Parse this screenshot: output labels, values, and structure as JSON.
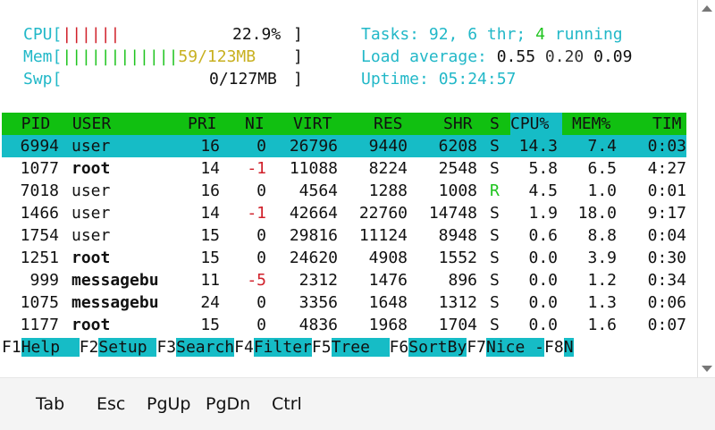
{
  "meters": {
    "cpu_label": "CPU[",
    "cpu_bar": "||||||",
    "cpu_value": "22.9%",
    "cpu_close": "]",
    "mem_label": "Mem[",
    "mem_bar_used": "||||||||||||",
    "mem_value": "59/123MB",
    "mem_close": "]",
    "swp_label": "Swp[",
    "swp_value": "0/127MB",
    "swp_close": "]"
  },
  "summary": {
    "tasks_label": "Tasks: ",
    "tasks_count": "92",
    "sep1": ", ",
    "threads": "6",
    "thr_label": " thr; ",
    "running": "4",
    "running_label": " running",
    "load_label": "Load average: ",
    "load1": "0.55",
    "load5": "0.20",
    "load15": "0.09",
    "uptime_label": "Uptime: ",
    "uptime": "05:24:57"
  },
  "columns": {
    "pid": "  PID",
    "user": " USER",
    "pri": "PRI",
    "ni": "NI",
    "virt": "VIRT",
    "res": "RES",
    "shr": "SHR",
    "s": "S",
    "cpu": "CPU%",
    "mem": "MEM%",
    "time": "TIM"
  },
  "processes": [
    {
      "pid": "6994",
      "user": "user",
      "pri": "16",
      "ni": "0",
      "virt": "26796",
      "res": "9440",
      "shr": "6208",
      "s": "S",
      "cpu": "14.3",
      "mem": "7.4",
      "time": "0:03"
    },
    {
      "pid": "1077",
      "user": "root",
      "pri": "14",
      "ni": "-1",
      "virt": "11088",
      "res": "8224",
      "shr": "2548",
      "s": "S",
      "cpu": "5.8",
      "mem": "6.5",
      "time": "4:27"
    },
    {
      "pid": "7018",
      "user": "user",
      "pri": "16",
      "ni": "0",
      "virt": "4564",
      "res": "1288",
      "shr": "1008",
      "s": "R",
      "cpu": "4.5",
      "mem": "1.0",
      "time": "0:01"
    },
    {
      "pid": "1466",
      "user": "user",
      "pri": "14",
      "ni": "-1",
      "virt": "42664",
      "res": "22760",
      "shr": "14748",
      "s": "S",
      "cpu": "1.9",
      "mem": "18.0",
      "time": "9:17"
    },
    {
      "pid": "1754",
      "user": "user",
      "pri": "15",
      "ni": "0",
      "virt": "29816",
      "res": "11124",
      "shr": "8948",
      "s": "S",
      "cpu": "0.6",
      "mem": "8.8",
      "time": "0:04"
    },
    {
      "pid": "1251",
      "user": "root",
      "pri": "15",
      "ni": "0",
      "virt": "24620",
      "res": "4908",
      "shr": "1552",
      "s": "S",
      "cpu": "0.0",
      "mem": "3.9",
      "time": "0:30"
    },
    {
      "pid": "999",
      "user": "messagebu",
      "pri": "11",
      "ni": "-5",
      "virt": "2312",
      "res": "1476",
      "shr": "896",
      "s": "S",
      "cpu": "0.0",
      "mem": "1.2",
      "time": "0:34"
    },
    {
      "pid": "1075",
      "user": "messagebu",
      "pri": "24",
      "ni": "0",
      "virt": "3356",
      "res": "1648",
      "shr": "1312",
      "s": "S",
      "cpu": "0.0",
      "mem": "1.3",
      "time": "0:06"
    },
    {
      "pid": "1177",
      "user": "root",
      "pri": "15",
      "ni": "0",
      "virt": "4836",
      "res": "1968",
      "shr": "1704",
      "s": "S",
      "cpu": "0.0",
      "mem": "1.6",
      "time": "0:07"
    }
  ],
  "fkeys": [
    {
      "key": "F1",
      "label": "Help  "
    },
    {
      "key": "F2",
      "label": "Setup "
    },
    {
      "key": "F3",
      "label": "Search"
    },
    {
      "key": "F4",
      "label": "Filter"
    },
    {
      "key": "F5",
      "label": "Tree  "
    },
    {
      "key": "F6",
      "label": "SortBy"
    },
    {
      "key": "F7",
      "label": "Nice -"
    },
    {
      "key": "F8",
      "label": "N"
    }
  ],
  "keybar": [
    "Tab",
    "Esc",
    "PgUp",
    "PgDn",
    "Ctrl"
  ]
}
